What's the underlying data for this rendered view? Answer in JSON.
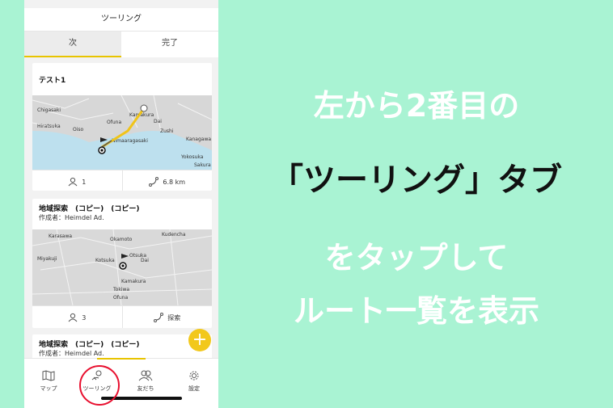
{
  "app": {
    "title": "ツーリング",
    "tabs": [
      {
        "label": "次",
        "active": true
      },
      {
        "label": "完了",
        "active": false
      }
    ],
    "cards": [
      {
        "title": "テスト1",
        "map_labels": [
          "Chigasaki",
          "Kamakura",
          "Ofuna",
          "Dai",
          "Zushi",
          "Hiratsuka",
          "Oiso",
          "Nimaaragasaki",
          "Kanagawa",
          "Yokosuka",
          "Sakura"
        ],
        "members": "1",
        "distance": "6.8 km"
      },
      {
        "title": "地域探索　(コピー)　(コピー)",
        "author": "作成者：Heimdel Ad.",
        "map_labels": [
          "Karasawa",
          "Okamoto",
          "Kudencha",
          "Miyakuji",
          "Kotsuka",
          "Otsuka",
          "Dai",
          "Kamakura",
          "Tokiwa",
          "Ofuna"
        ],
        "members": "3",
        "distance": "探索"
      },
      {
        "title": "地域探索　(コピー)　(コピー)",
        "author": "作成者：Heimdel Ad."
      }
    ],
    "fab_label": "+",
    "bottom_nav": [
      {
        "label": "マップ",
        "icon": "map-icon"
      },
      {
        "label": "ツーリング",
        "icon": "touring-icon",
        "active": true
      },
      {
        "label": "友だち",
        "icon": "friends-icon"
      },
      {
        "label": "設定",
        "icon": "gear-icon"
      }
    ]
  },
  "caption": {
    "line1": "左から2番目の",
    "line2": "「ツーリング」タブ",
    "line3": "をタップして",
    "line4": "ルート一覧を表示"
  },
  "colors": {
    "background": "#a9f3d3",
    "accent": "#e8c400",
    "fab": "#f2c81c",
    "highlight": "#e8102f",
    "route": "#f0c419"
  }
}
